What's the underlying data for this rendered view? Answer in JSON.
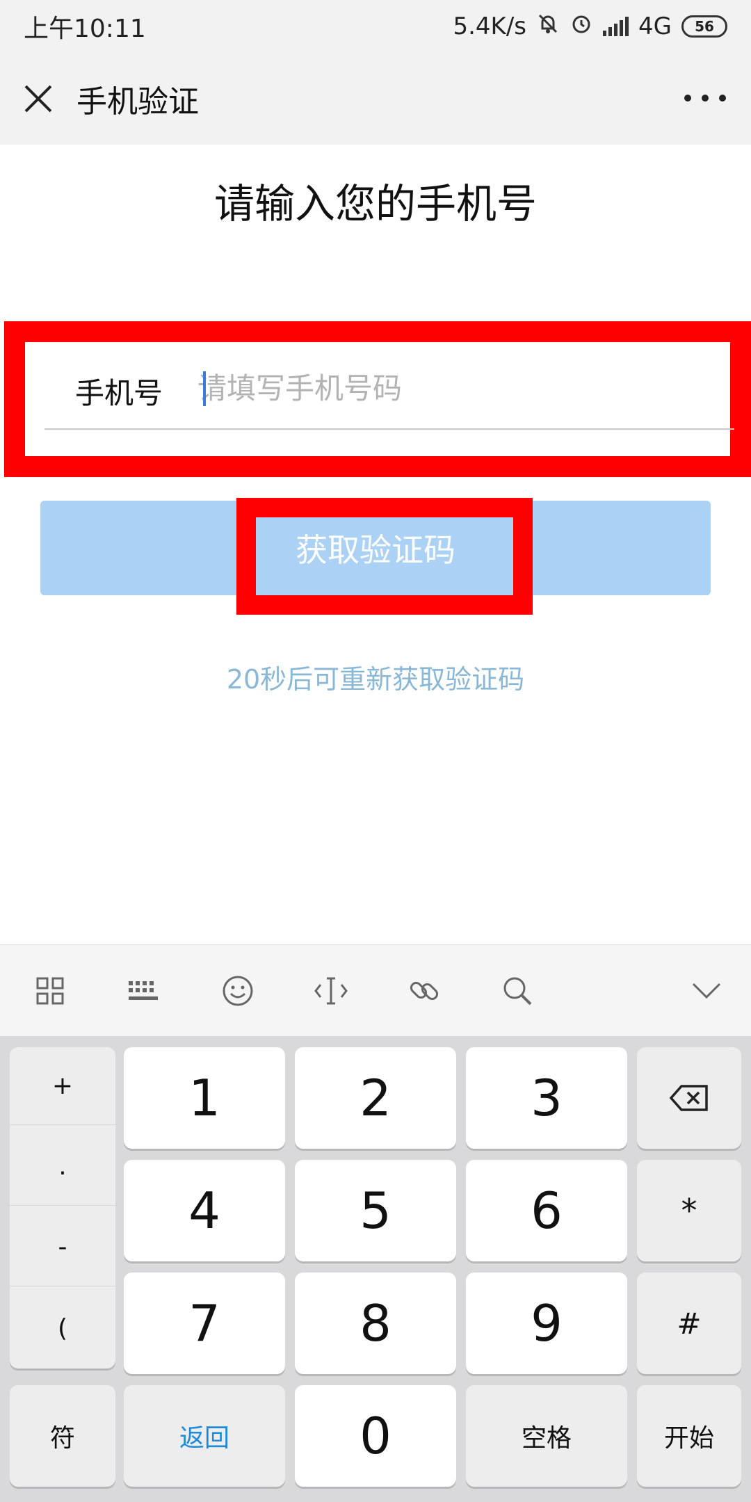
{
  "status": {
    "time": "上午10:11",
    "speed": "5.4K/s",
    "network": "4G",
    "battery": "56"
  },
  "nav": {
    "title": "手机验证"
  },
  "main": {
    "headline": "请输入您的手机号",
    "phone_label": "手机号",
    "phone_placeholder": "请填写手机号码",
    "phone_value": "",
    "code_button_label": "获取验证码",
    "resend_text": "20秒后可重新获取验证码"
  },
  "colors": {
    "highlight": "#ff0000",
    "button_bg": "#abd2f4",
    "resend_text": "#8ab7d6",
    "return_key_text": "#1f8bd8"
  },
  "toolbar": {
    "icons": [
      "grid-icon",
      "keyboard-icon",
      "emoji-icon",
      "cursor-icon",
      "link-icon",
      "search-icon",
      "chevron-down-icon"
    ]
  },
  "keyboard": {
    "symbols": [
      "+",
      ".",
      "-",
      "("
    ],
    "digits": [
      "1",
      "2",
      "3",
      "4",
      "5",
      "6",
      "7",
      "8",
      "9",
      "0"
    ],
    "asterisk": "*",
    "hash": "#",
    "symbol_key": "符",
    "return_key": "返回",
    "space_key": "空格",
    "go_key": "开始"
  }
}
